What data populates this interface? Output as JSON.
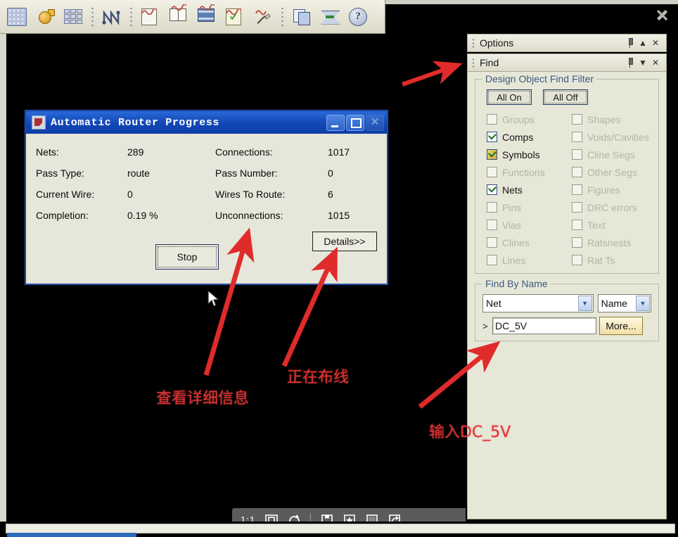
{
  "app": {
    "toolbar_icons": [
      {
        "name": "board-grid-icon"
      },
      {
        "name": "ti-logo-icon"
      },
      {
        "name": "components-grid-icon"
      },
      {
        "name": "route-path-icon"
      },
      {
        "name": "new-file-icon"
      },
      {
        "name": "open-book-icon"
      },
      {
        "name": "film-strip-icon"
      },
      {
        "name": "checklist-icon"
      },
      {
        "name": "signal-pen-icon"
      },
      {
        "name": "copy-pages-icon"
      },
      {
        "name": "envelope-icon"
      },
      {
        "name": "help-icon"
      }
    ],
    "window_close_label": "✕"
  },
  "dialog": {
    "title": "Automatic Router Progress",
    "icon": "router-app-icon",
    "minimize_label": "_",
    "maximize_label": "□",
    "close_label": "✕",
    "fields": [
      {
        "label": "Nets:",
        "value": "289",
        "label2": "Connections:",
        "value2": "1017"
      },
      {
        "label": "Pass Type:",
        "value": "route",
        "label2": "Pass Number:",
        "value2": "0"
      },
      {
        "label": "Current Wire:",
        "value": "0",
        "label2": "Wires To Route:",
        "value2": "6"
      },
      {
        "label": "Completion:",
        "value": "0.19 %",
        "label2": "Unconnections:",
        "value2": "1015"
      }
    ],
    "stop_button": "Stop",
    "details_button": "Details>>"
  },
  "options_panel": {
    "title": "Options",
    "pin_icon": "pin-icon",
    "collapse_icon": "▲",
    "close_icon": "✕"
  },
  "find_panel": {
    "title": "Find",
    "pin_icon": "pin-icon",
    "collapse_icon": "▼",
    "close_icon": "✕",
    "filter_legend": "Design Object Find Filter",
    "all_on": "All On",
    "all_off": "All Off",
    "filters_left": [
      {
        "label": "Groups",
        "checked": false
      },
      {
        "label": "Comps",
        "checked": true
      },
      {
        "label": "Symbols",
        "checked": true
      },
      {
        "label": "Functions",
        "checked": false
      },
      {
        "label": "Nets",
        "checked": true
      },
      {
        "label": "Pins",
        "checked": false
      },
      {
        "label": "Vias",
        "checked": false
      },
      {
        "label": "Clines",
        "checked": false
      },
      {
        "label": "Lines",
        "checked": false
      }
    ],
    "filters_right": [
      {
        "label": "Shapes",
        "checked": false
      },
      {
        "label": "Voids/Cavities",
        "checked": false
      },
      {
        "label": "Cline Segs",
        "checked": false
      },
      {
        "label": "Other Segs",
        "checked": false
      },
      {
        "label": "Figures",
        "checked": false
      },
      {
        "label": "DRC errors",
        "checked": false
      },
      {
        "label": "Text",
        "checked": false
      },
      {
        "label": "Ratsnests",
        "checked": false
      },
      {
        "label": "Rat Ts",
        "checked": false
      }
    ],
    "find_by_name_legend": "Find By Name",
    "object_type": "Net",
    "match_mode": "Name",
    "prompt_symbol": ">",
    "name_value": "DC_5V",
    "more_button": "More...",
    "dropdown_arrow": "▼"
  },
  "bottom_toolbar": {
    "zoom_ratio": "1:1",
    "icons": [
      {
        "name": "fit-to-screen-icon"
      },
      {
        "name": "rotate-right-icon"
      },
      {
        "name": "save-icon"
      },
      {
        "name": "favorite-star-icon"
      },
      {
        "name": "display-icon"
      },
      {
        "name": "share-icon"
      }
    ]
  },
  "annotations": [
    {
      "text": "查看详细信息",
      "name": "annotation-view-details"
    },
    {
      "text": "正在布线",
      "name": "annotation-routing-in-progress"
    },
    {
      "text": "输入DC_5V",
      "name": "annotation-input-dc5v"
    }
  ],
  "colors": {
    "accent_red": "#e03232",
    "dialog_titlebar": "#1147b5",
    "panel_bg": "#e7e7d8",
    "canvas_bg": "#000000"
  }
}
